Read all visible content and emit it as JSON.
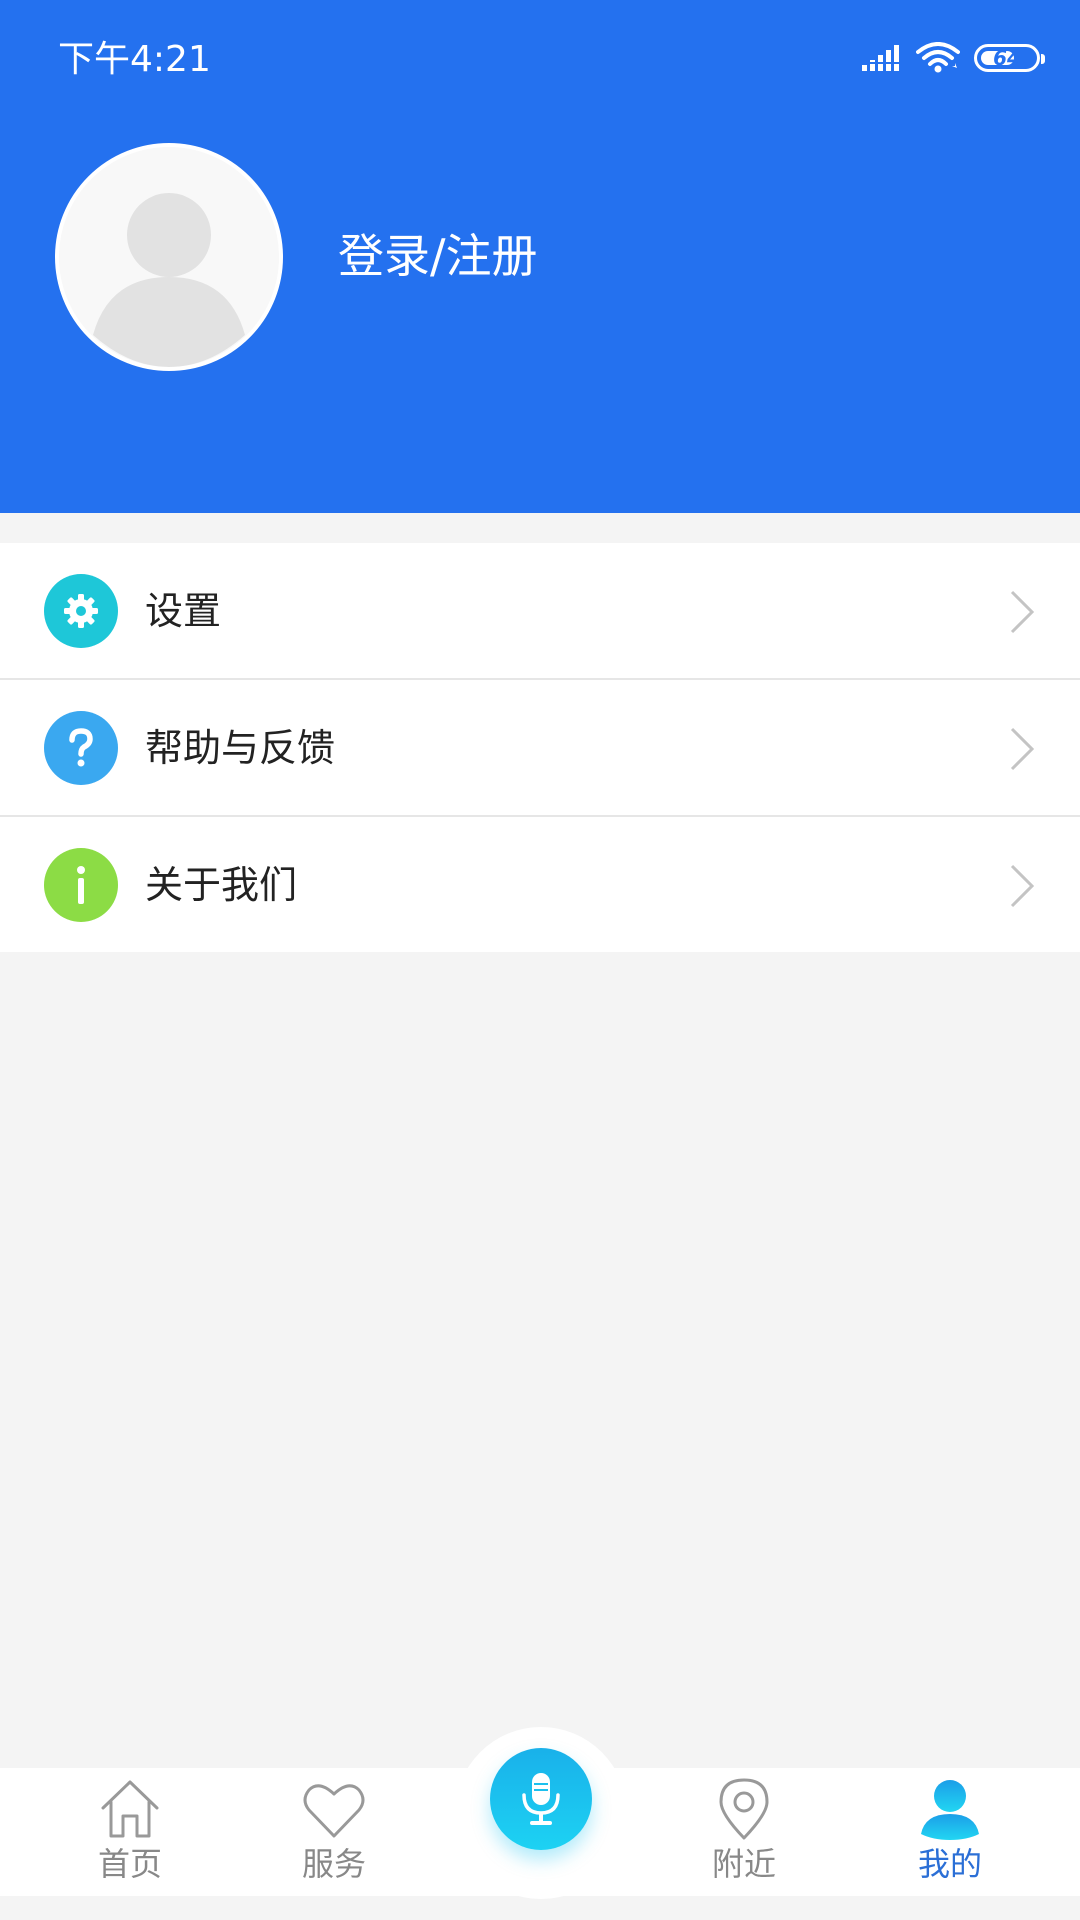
{
  "status_bar": {
    "time": "下午4:21",
    "battery": "64",
    "battery_percent": 64,
    "icons": [
      "signal-icon",
      "wifi-icon",
      "battery-icon"
    ]
  },
  "profile": {
    "avatar_icon": "default-avatar-icon",
    "login_label": "登录/注册"
  },
  "menu": {
    "items": [
      {
        "label": "设置",
        "icon": "gear-icon",
        "color": "#1ec7d8"
      },
      {
        "label": "帮助与反馈",
        "icon": "question-icon",
        "color": "#3aa8f0"
      },
      {
        "label": "关于我们",
        "icon": "info-icon",
        "color": "#8cdc45"
      }
    ]
  },
  "tabbar": {
    "tabs": [
      {
        "label": "首页",
        "icon": "home-icon",
        "active": false
      },
      {
        "label": "服务",
        "icon": "heart-icon",
        "active": false
      },
      {
        "label": "附近",
        "icon": "location-pin-icon",
        "active": false
      },
      {
        "label": "我的",
        "icon": "person-icon",
        "active": true
      }
    ],
    "center_button_icon": "microphone-icon"
  },
  "colors": {
    "header": "#2471ef",
    "active_tab": "#2b6fd6",
    "inactive_tab": "#888888",
    "mic_button": "#1dc0ee"
  }
}
